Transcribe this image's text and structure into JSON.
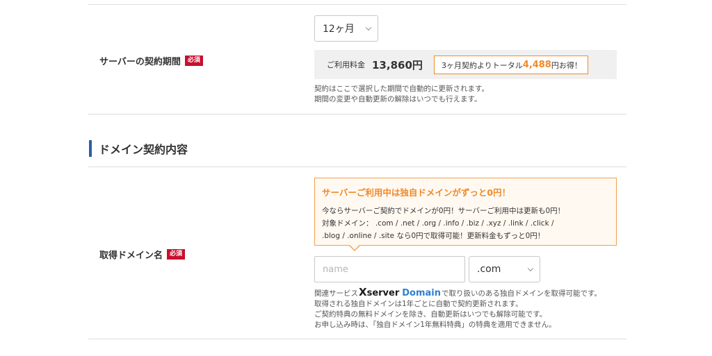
{
  "contract": {
    "label": "サーバーの契約期間",
    "required_badge": "必須",
    "period_selected": "12ヶ月",
    "price_label": "ご利用料金",
    "price_value": "13,860円",
    "savings_prefix": "3ヶ月契約よりトータル",
    "savings_amount": "4,488",
    "savings_suffix": "円お得！",
    "notes": [
      "契約はここで選択した期間で自動的に更新されます。",
      "期間の変更や自動更新の解除はいつでも行えます。"
    ]
  },
  "domain_section": {
    "title": "ドメイン契約内容"
  },
  "domain": {
    "label": "取得ドメイン名",
    "required_badge": "必須",
    "promo_title": "サーバーご利用中は独自ドメインがずっと0円！",
    "promo_lines": [
      "今ならサーバーご契約でドメインが0円！サーバーご利用中は更新も0円！",
      "対象ドメイン：  .com / .net / .org / .info / .biz / .xyz / .link / .click /",
      ".blog / .online / .site なら0円で取得可能！更新料金もずっと0円！"
    ],
    "name_placeholder": "name",
    "tld_selected": ".com",
    "related_prefix": "関連サービス",
    "brand_x": "X",
    "brand_server": "server",
    "brand_domain": "Domain",
    "related_suffix": "で取り扱いのある独自ドメインを取得可能です。",
    "notes": [
      "取得される独自ドメインは1年ごとに自動で契約更新されます。",
      "ご契約特典の無料ドメインを除き、自動更新はいつでも解除可能です。",
      "お申し込み時は、「独自ドメイン1年無料特典」の特典を適用できません。"
    ]
  },
  "colors": {
    "required": "#c8102e",
    "accent_orange": "#f08a28",
    "section_bar": "#2b5ea8",
    "brand_blue": "#2e7fd1"
  }
}
